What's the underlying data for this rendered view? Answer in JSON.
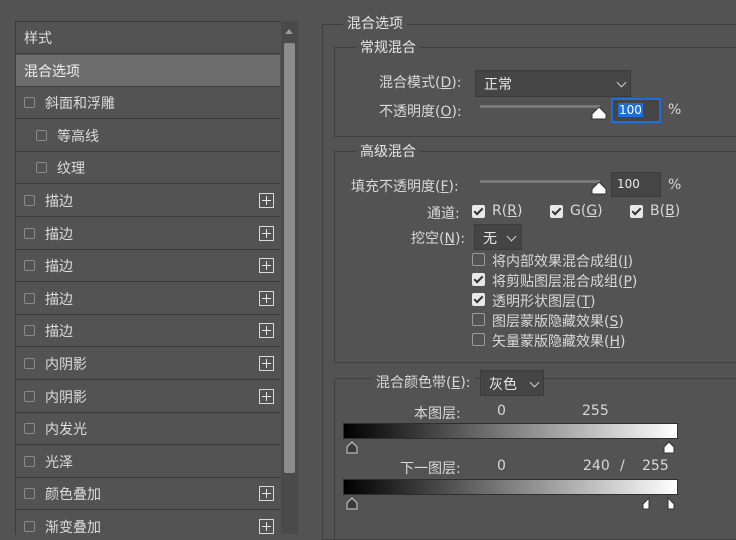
{
  "left_panel": {
    "header": "样式",
    "items": [
      {
        "label": "混合选项",
        "selected": true,
        "checkbox": false,
        "plus": false,
        "indent": false
      },
      {
        "label": "斜面和浮雕",
        "checkbox": true,
        "plus": false,
        "indent": false
      },
      {
        "label": "等高线",
        "checkbox": true,
        "plus": false,
        "indent": true
      },
      {
        "label": "纹理",
        "checkbox": true,
        "plus": false,
        "indent": true
      },
      {
        "label": "描边",
        "checkbox": true,
        "plus": true,
        "indent": false
      },
      {
        "label": "描边",
        "checkbox": true,
        "plus": true,
        "indent": false
      },
      {
        "label": "描边",
        "checkbox": true,
        "plus": true,
        "indent": false
      },
      {
        "label": "描边",
        "checkbox": true,
        "plus": true,
        "indent": false
      },
      {
        "label": "描边",
        "checkbox": true,
        "plus": true,
        "indent": false
      },
      {
        "label": "内阴影",
        "checkbox": true,
        "plus": true,
        "indent": false
      },
      {
        "label": "内阴影",
        "checkbox": true,
        "plus": true,
        "indent": false
      },
      {
        "label": "内发光",
        "checkbox": true,
        "plus": false,
        "indent": false
      },
      {
        "label": "光泽",
        "checkbox": true,
        "plus": false,
        "indent": false
      },
      {
        "label": "颜色叠加",
        "checkbox": true,
        "plus": true,
        "indent": false
      },
      {
        "label": "渐变叠加",
        "checkbox": true,
        "plus": true,
        "indent": false
      }
    ]
  },
  "blend_options": {
    "title": "混合选项",
    "general": {
      "title": "常规混合",
      "mode_label": "混合模式(",
      "mode_key": "D",
      "mode_value": "正常",
      "opacity_label": "不透明度(",
      "opacity_key": "O",
      "opacity_value": "100",
      "opacity_unit": "%",
      "opacity_level": 1.0
    },
    "advanced": {
      "title": "高级混合",
      "fill_label": "填充不透明度(",
      "fill_key": "F",
      "fill_value": "100",
      "fill_unit": "%",
      "fill_level": 1.0,
      "channels_label": "通道:",
      "channels": [
        {
          "name": "R(",
          "key": "R",
          "checked": true
        },
        {
          "name": "G(",
          "key": "G",
          "checked": true
        },
        {
          "name": "B(",
          "key": "B",
          "checked": true
        }
      ],
      "knockout_label": "挖空(",
      "knockout_key": "N",
      "knockout_value": "无",
      "options": [
        {
          "label": "将内部效果混合成组(",
          "key": "I",
          "checked": false
        },
        {
          "label": "将剪贴图层混合成组(",
          "key": "P",
          "checked": true
        },
        {
          "label": "透明形状图层(",
          "key": "T",
          "checked": true
        },
        {
          "label": "图层蒙版隐藏效果(",
          "key": "S",
          "checked": false
        },
        {
          "label": "矢量蒙版隐藏效果(",
          "key": "H",
          "checked": false
        }
      ]
    },
    "blend_if": {
      "label": "混合颜色带(",
      "key": "E",
      "value": "灰色",
      "this_layer": {
        "label": "本图层:",
        "low": "0",
        "high": "255"
      },
      "underlying": {
        "label": "下一图层:",
        "low": "0",
        "high_split": "240",
        "slash": "/",
        "high": "255"
      }
    }
  },
  "colors": {
    "panel_bg": "#535353",
    "selected_row": "#6d6d6d",
    "field_bg": "#454545",
    "focus": "#1e6fd9"
  }
}
